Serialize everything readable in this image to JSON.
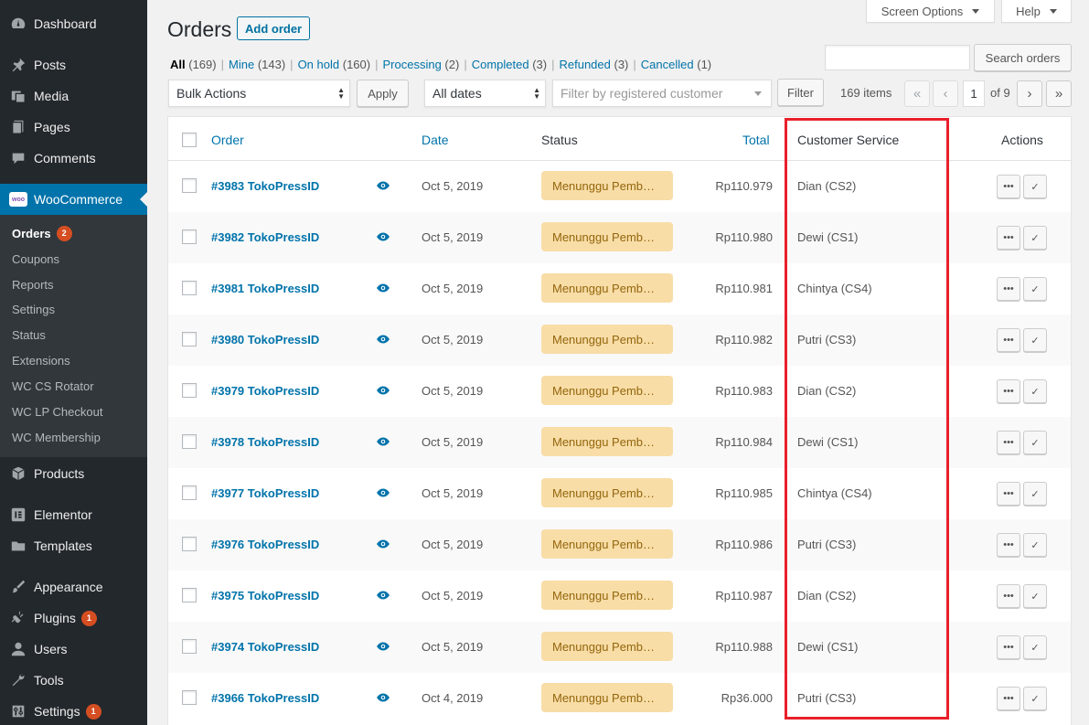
{
  "sidebar": {
    "menu": [
      {
        "label": "Dashboard",
        "icon": "dashboard-icon"
      },
      {
        "label": "Posts",
        "icon": "pushpin-icon"
      },
      {
        "label": "Media",
        "icon": "media-icon"
      },
      {
        "label": "Pages",
        "icon": "pages-icon"
      },
      {
        "label": "Comments",
        "icon": "comment-icon"
      },
      {
        "label": "WooCommerce",
        "icon": "woocommerce-icon"
      },
      {
        "label": "Products",
        "icon": "products-icon"
      },
      {
        "label": "Elementor",
        "icon": "elementor-icon"
      },
      {
        "label": "Templates",
        "icon": "folder-icon"
      },
      {
        "label": "Appearance",
        "icon": "brush-icon"
      },
      {
        "label": "Plugins",
        "icon": "plugin-icon",
        "badge": "1"
      },
      {
        "label": "Users",
        "icon": "user-icon"
      },
      {
        "label": "Tools",
        "icon": "wrench-icon"
      },
      {
        "label": "Settings",
        "icon": "settings-icon",
        "badge": "1"
      }
    ],
    "woo_logo_text": "woo",
    "submenu": [
      {
        "label": "Orders",
        "badge": "2"
      },
      {
        "label": "Coupons"
      },
      {
        "label": "Reports"
      },
      {
        "label": "Settings"
      },
      {
        "label": "Status"
      },
      {
        "label": "Extensions"
      },
      {
        "label": "WC CS Rotator"
      },
      {
        "label": "WC LP Checkout"
      },
      {
        "label": "WC Membership"
      }
    ]
  },
  "header": {
    "title": "Orders",
    "add_button": "Add order",
    "screen_options": "Screen Options",
    "help": "Help"
  },
  "views": [
    {
      "label": "All",
      "count": "(169)"
    },
    {
      "label": "Mine",
      "count": "(143)"
    },
    {
      "label": "On hold",
      "count": "(160)"
    },
    {
      "label": "Processing",
      "count": "(2)"
    },
    {
      "label": "Completed",
      "count": "(3)"
    },
    {
      "label": "Refunded",
      "count": "(3)"
    },
    {
      "label": "Cancelled",
      "count": "(1)"
    }
  ],
  "search": {
    "button": "Search orders",
    "value": ""
  },
  "tablenav": {
    "bulk_actions": "Bulk Actions",
    "apply": "Apply",
    "dates": "All dates",
    "customer_placeholder": "Filter by registered customer",
    "filter": "Filter",
    "items": "169 items",
    "first": "«",
    "prev": "‹",
    "current_page": "1",
    "of_pages": "of 9",
    "next": "›",
    "last": "»"
  },
  "columns": {
    "order": "Order",
    "date": "Date",
    "status": "Status",
    "total": "Total",
    "customer_service": "Customer Service",
    "actions": "Actions"
  },
  "orders": [
    {
      "order": "#3983 TokoPressID",
      "date": "Oct 5, 2019",
      "status": "Menunggu Pemb…",
      "total": "Rp110.979",
      "cs": "Dian (CS2)"
    },
    {
      "order": "#3982 TokoPressID",
      "date": "Oct 5, 2019",
      "status": "Menunggu Pemb…",
      "total": "Rp110.980",
      "cs": "Dewi (CS1)"
    },
    {
      "order": "#3981 TokoPressID",
      "date": "Oct 5, 2019",
      "status": "Menunggu Pemb…",
      "total": "Rp110.981",
      "cs": "Chintya (CS4)"
    },
    {
      "order": "#3980 TokoPressID",
      "date": "Oct 5, 2019",
      "status": "Menunggu Pemb…",
      "total": "Rp110.982",
      "cs": "Putri (CS3)"
    },
    {
      "order": "#3979 TokoPressID",
      "date": "Oct 5, 2019",
      "status": "Menunggu Pemb…",
      "total": "Rp110.983",
      "cs": "Dian (CS2)"
    },
    {
      "order": "#3978 TokoPressID",
      "date": "Oct 5, 2019",
      "status": "Menunggu Pemb…",
      "total": "Rp110.984",
      "cs": "Dewi (CS1)"
    },
    {
      "order": "#3977 TokoPressID",
      "date": "Oct 5, 2019",
      "status": "Menunggu Pemb…",
      "total": "Rp110.985",
      "cs": "Chintya (CS4)"
    },
    {
      "order": "#3976 TokoPressID",
      "date": "Oct 5, 2019",
      "status": "Menunggu Pemb…",
      "total": "Rp110.986",
      "cs": "Putri (CS3)"
    },
    {
      "order": "#3975 TokoPressID",
      "date": "Oct 5, 2019",
      "status": "Menunggu Pemb…",
      "total": "Rp110.987",
      "cs": "Dian (CS2)"
    },
    {
      "order": "#3974 TokoPressID",
      "date": "Oct 5, 2019",
      "status": "Menunggu Pemb…",
      "total": "Rp110.988",
      "cs": "Dewi (CS1)"
    },
    {
      "order": "#3966 TokoPressID",
      "date": "Oct 4, 2019",
      "status": "Menunggu Pemb…",
      "total": "Rp36.000",
      "cs": "Putri (CS3)"
    }
  ],
  "colors": {
    "accent": "#0073aa",
    "sidebar": "#23282d",
    "status_bg": "#f8dda7",
    "highlight": "#e8202a"
  }
}
